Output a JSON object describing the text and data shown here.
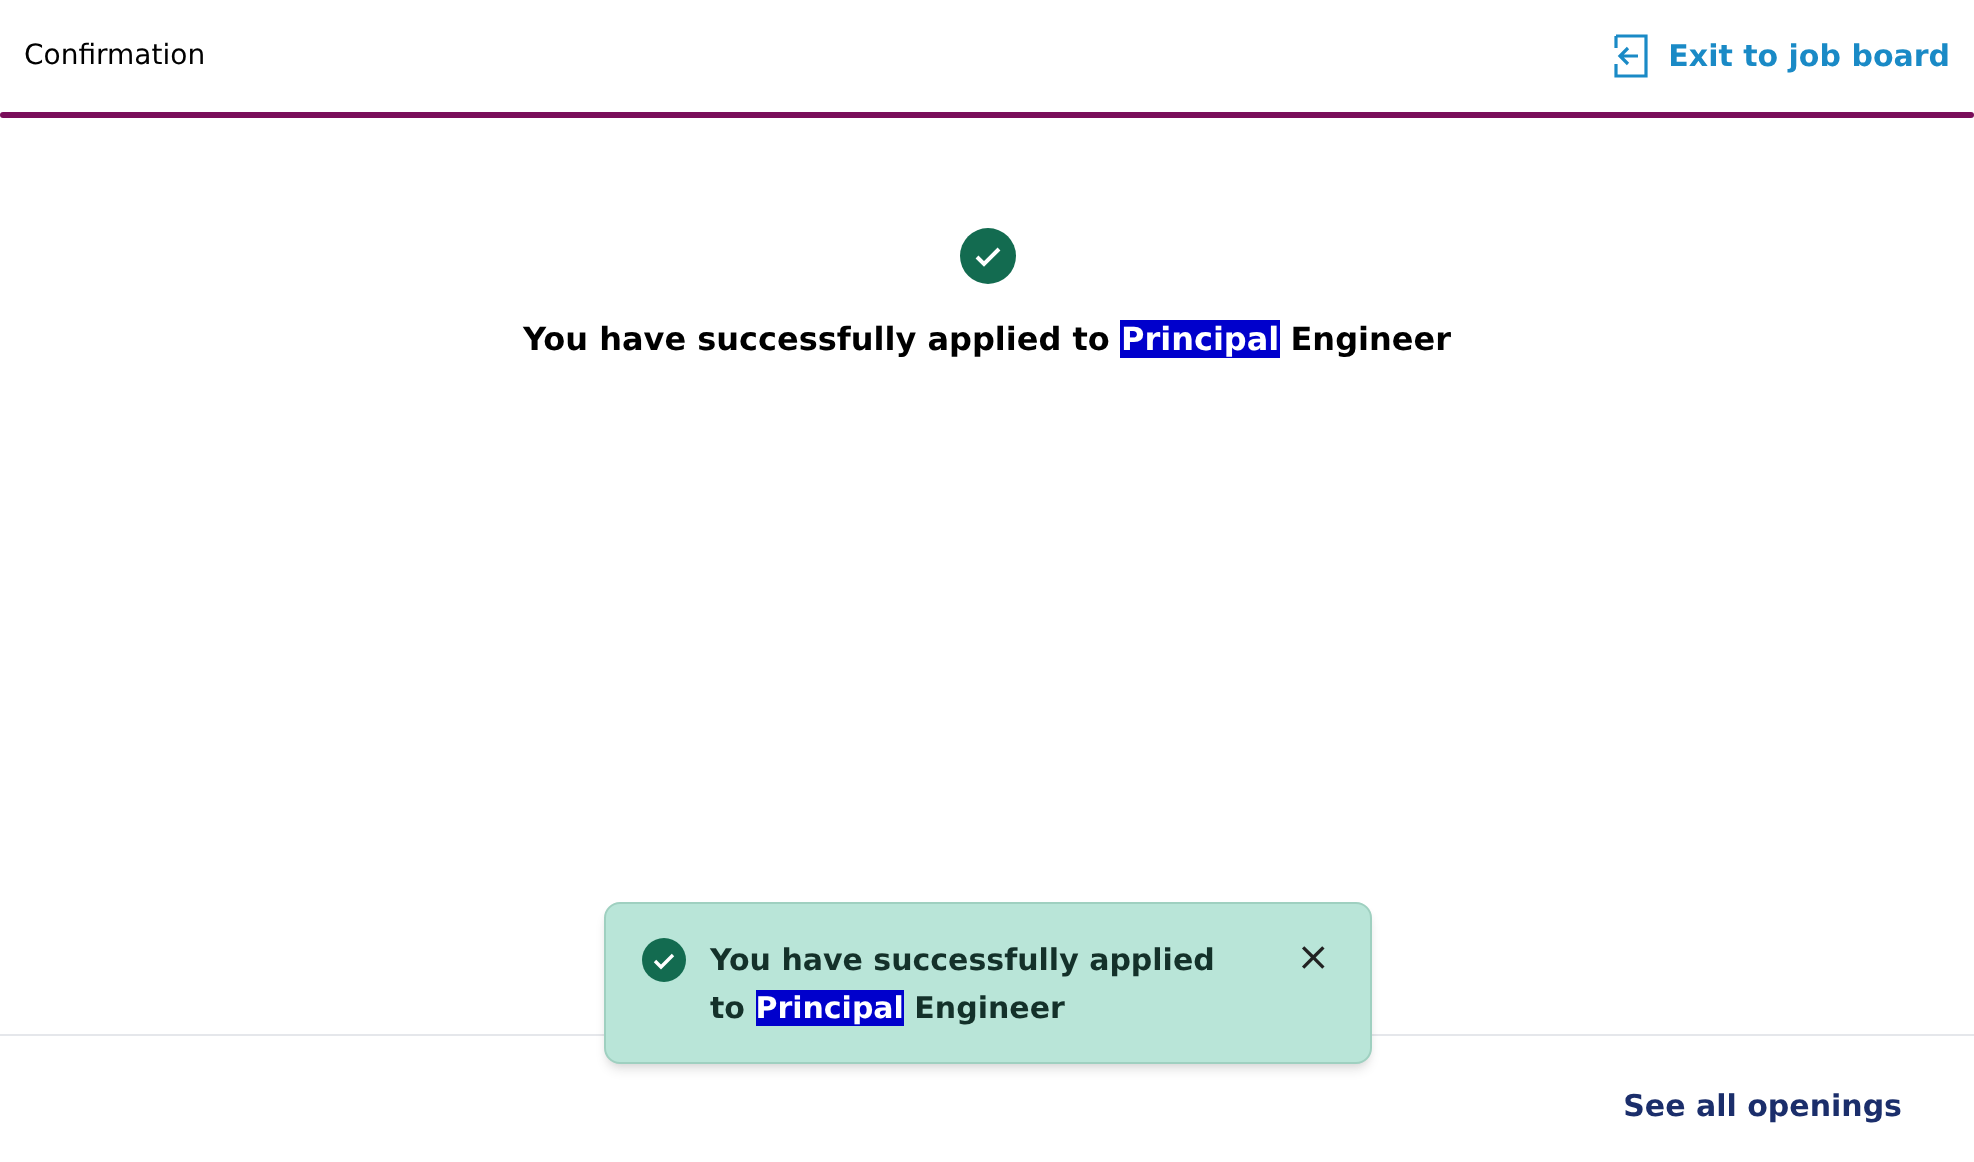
{
  "header": {
    "title": "Confirmation",
    "exit_link": "Exit to job board"
  },
  "confirmation": {
    "message": [
      {
        "text": "You have successfully applied to ",
        "highlighted": false
      },
      {
        "text": "Principal",
        "highlighted": true
      },
      {
        "text": " Engineer",
        "highlighted": false
      }
    ]
  },
  "toast": {
    "message": [
      {
        "text": "You have successfully applied to ",
        "highlighted": false
      },
      {
        "text": "Principal",
        "highlighted": true
      },
      {
        "text": " Engineer",
        "highlighted": false
      }
    ],
    "close": "×"
  },
  "footer": {
    "link": "See all openings"
  }
}
